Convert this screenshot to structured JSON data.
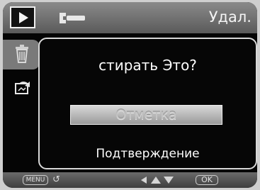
{
  "header": {
    "active_tab_icon": "play-icon",
    "settings_icon": "wrench-icon",
    "title": "Удал."
  },
  "sidebar": {
    "items": [
      {
        "icon": "trash-icon",
        "selected": true
      },
      {
        "icon": "rotate-icon",
        "selected": false
      }
    ]
  },
  "dialog": {
    "question": "стирать Это?",
    "options": [
      {
        "label": "Отметка",
        "state": "highlighted"
      },
      {
        "label": "Подтверждение",
        "state": "normal"
      }
    ]
  },
  "footer": {
    "menu_key": "MENU",
    "back_icon": "return-arrow-icon",
    "nav_icon": "left-up-down-arrows-icon",
    "ok_key": "OK"
  }
}
